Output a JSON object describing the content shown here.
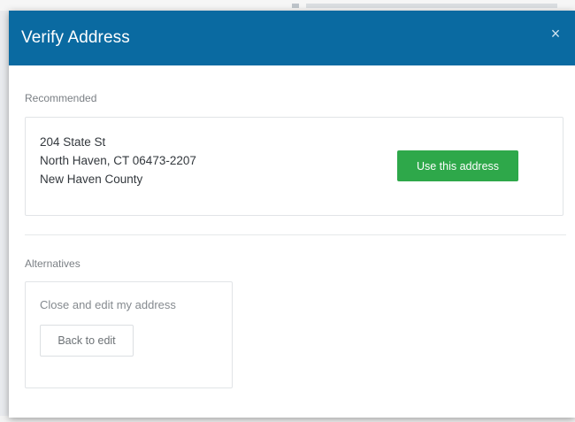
{
  "modal": {
    "title": "Verify Address",
    "close_glyph": "×"
  },
  "recommended": {
    "label": "Recommended",
    "address": {
      "line1": "204 State St",
      "line2": "North Haven, CT 06473-2207",
      "line3": "New Haven County"
    },
    "button_label": "Use this address"
  },
  "alternatives": {
    "label": "Alternatives",
    "text": "Close and edit my address",
    "button_label": "Back to edit"
  },
  "colors": {
    "header_bg": "#0a6aa1",
    "primary_button": "#2ea84a"
  }
}
